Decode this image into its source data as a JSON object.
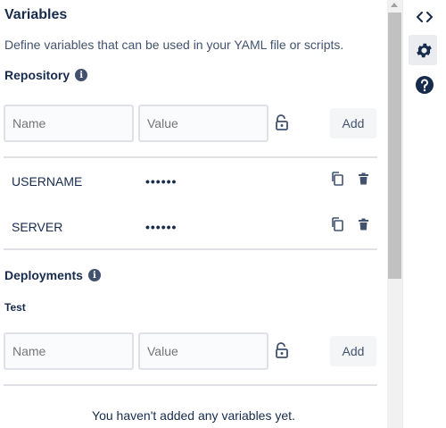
{
  "panel": {
    "title": "Variables",
    "description": "Define variables that can be used in your YAML file or scripts."
  },
  "repository": {
    "heading": "Repository",
    "info_icon": "info-icon",
    "name_placeholder": "Name",
    "value_placeholder": "Value",
    "lock_icon": "unlocked-padlock-icon",
    "add_label": "Add",
    "variables": [
      {
        "name": "USERNAME",
        "value": "••••••",
        "copy_icon": "copy-icon",
        "delete_icon": "trash-icon"
      },
      {
        "name": "SERVER",
        "value": "••••••",
        "copy_icon": "copy-icon",
        "delete_icon": "trash-icon"
      }
    ]
  },
  "deployments": {
    "heading": "Deployments",
    "info_icon": "info-icon",
    "environment": "Test",
    "name_placeholder": "Name",
    "value_placeholder": "Value",
    "lock_icon": "unlocked-padlock-icon",
    "add_label": "Add",
    "empty_message": "You haven't added any variables yet."
  },
  "rail": {
    "items": [
      {
        "icon": "code-icon",
        "active": false
      },
      {
        "icon": "gear-icon",
        "active": true
      },
      {
        "icon": "help-icon",
        "active": false
      }
    ]
  },
  "colors": {
    "text": "#172b4d",
    "secondary_text": "#42526e",
    "field_border": "#dfe1e6",
    "button_bg": "#f4f5f7",
    "rail_active_bg": "#ebecf0"
  }
}
